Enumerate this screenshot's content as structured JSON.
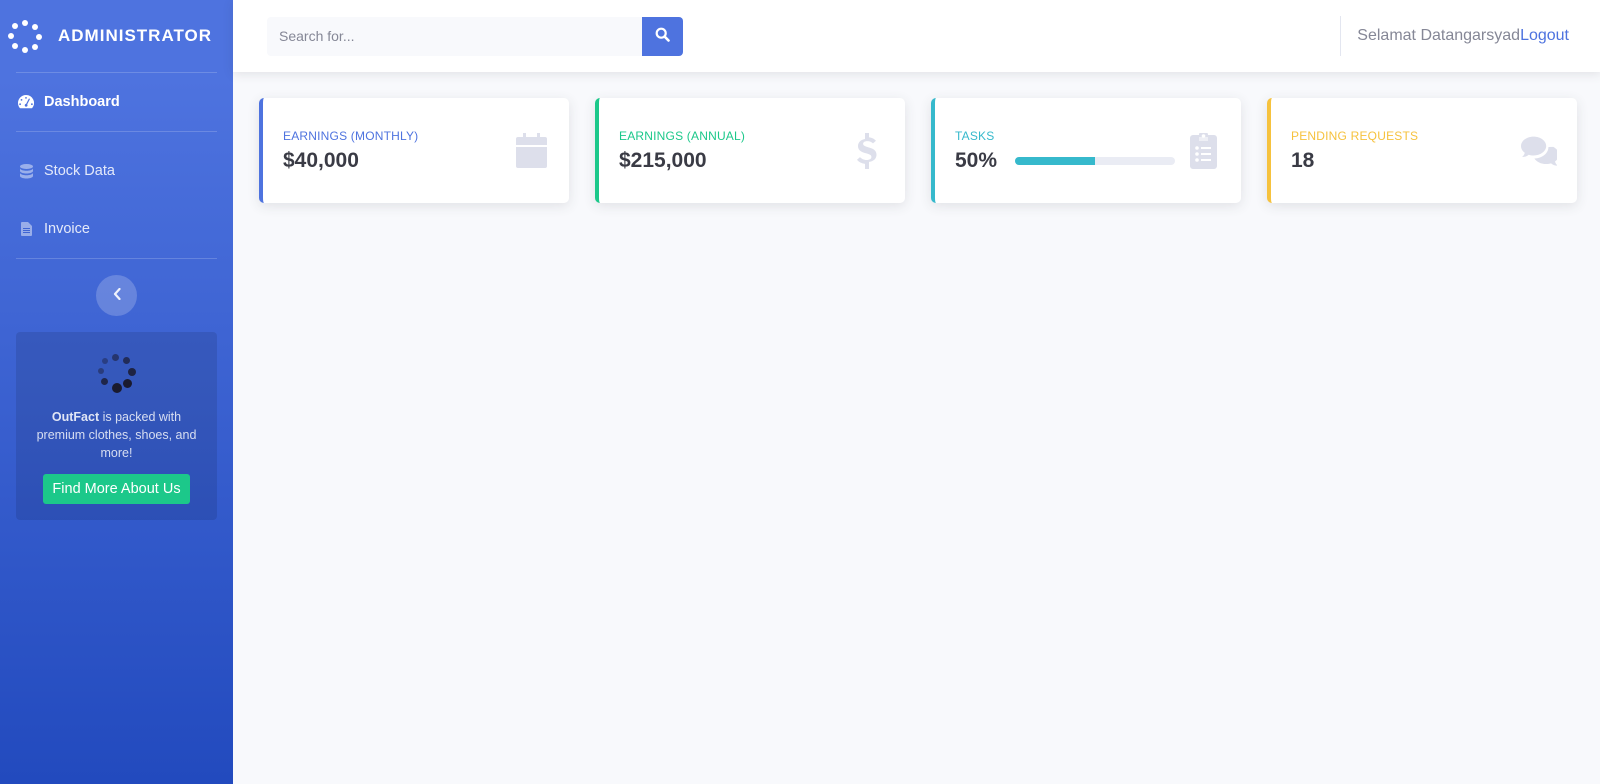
{
  "brand": {
    "title": "ADMINISTRATOR"
  },
  "sidebar": {
    "items": [
      {
        "label": "Dashboard",
        "active": true
      },
      {
        "label": "Stock Data"
      },
      {
        "label": "Invoice"
      }
    ],
    "promo": {
      "brand_name": "OutFact",
      "text": " is packed with premium clothes, shoes, and more!",
      "button": "Find More About Us"
    }
  },
  "search": {
    "placeholder": "Search for..."
  },
  "user": {
    "greeting": "Selamat Datangarsyad",
    "logout": "Logout"
  },
  "cards": [
    {
      "label": "Earnings (Monthly)",
      "value": "$40,000",
      "color": "#4e73df",
      "icon": "calendar-icon"
    },
    {
      "label": "Earnings (Annual)",
      "value": "$215,000",
      "color": "#1cc88a",
      "icon": "dollar-icon"
    },
    {
      "label": "Tasks",
      "value": "50%",
      "progress": 0.5,
      "color": "#36b9cc",
      "icon": "clipboard-list-icon"
    },
    {
      "label": "Pending Requests",
      "value": "18",
      "color": "#f6c23e",
      "icon": "comments-icon"
    }
  ]
}
